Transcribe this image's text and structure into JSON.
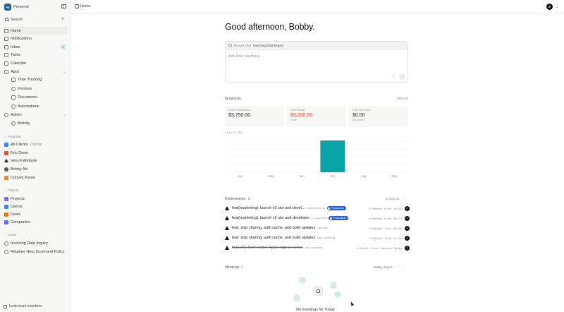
{
  "sidebar": {
    "workspace": {
      "badge": "PE",
      "name": "Personal"
    },
    "search_label": "Search",
    "items": [
      {
        "label": "Home"
      },
      {
        "label": "Notifications"
      },
      {
        "label": "Inbox",
        "badge": "4"
      },
      {
        "label": "Tasks"
      },
      {
        "label": "Calendar"
      },
      {
        "label": "Apps"
      },
      {
        "label": "Time Tracking"
      },
      {
        "label": "Invoices"
      },
      {
        "label": "Documents"
      },
      {
        "label": "Automations"
      },
      {
        "label": "Admin"
      },
      {
        "label": "Activity"
      }
    ],
    "favorites_label": "Favorites",
    "favorites": [
      {
        "label": "All Clients",
        "meta": "Clients"
      },
      {
        "label": "Eric Owen"
      },
      {
        "label": "Verum Website"
      },
      {
        "label": "Bobby Alv"
      },
      {
        "label": "Convex Panel"
      }
    ],
    "objects_label": "Objects",
    "objects": [
      {
        "label": "Projects",
        "color": "#7b6cf0"
      },
      {
        "label": "Clients",
        "color": "#3b82f6"
      },
      {
        "label": "Deals",
        "color": "#f97316"
      },
      {
        "label": "Companies",
        "color": "#6366f1"
      }
    ],
    "chats_label": "Chats",
    "chats": [
      {
        "label": "Invoicing Data Inquiry"
      },
      {
        "label": "Retainer Hour Increment Policy"
      }
    ],
    "invite_label": "Invite team members"
  },
  "topbar": {
    "breadcrumb": "Home",
    "avatar": "Z",
    "more": "⋮"
  },
  "greeting": "Good afternoon, Bobby.",
  "chat": {
    "recent_label": "Recent chat",
    "recent_title": "Invoicing Data Inquiry",
    "placeholder": "Ask Kaio anything...",
    "attach": "⁝",
    "send": "→"
  },
  "financials": {
    "title": "Financials",
    "view_all": "View all",
    "cards": [
      {
        "label": "OUTSTANDING",
        "value": "$3,750.00",
        "sub": ""
      },
      {
        "label": "OVERDUE",
        "value": "$3,000.00",
        "sub": "1 late"
      },
      {
        "label": "COLLECTED",
        "value": "$0.00",
        "sub": "this month"
      }
    ],
    "collected_label": "COLLECTED"
  },
  "chart_data": {
    "type": "bar",
    "categories": [
      "Apr",
      "May",
      "Jun",
      "Jul",
      "Aug",
      "Sep"
    ],
    "values": [
      0,
      0,
      0,
      1,
      0,
      0
    ],
    "ylim": [
      0,
      1
    ],
    "grid": true,
    "bar_color": "#0aa3a8",
    "highlight_category": "Jul"
  },
  "deployments": {
    "title": "Deployments",
    "count": "1L",
    "projects_label": "2 projects",
    "more": "⋮",
    "rows": [
      {
        "msg": "feat(marketing): launch v2 site and devel...",
        "project": "kaio-marketing",
        "env": "Production",
        "commit": "⊙ 9fab9b6",
        "author": "6 min",
        "time": "1m 33s",
        "strike": false
      },
      {
        "msg": "feat(marketing): launch v2 site and developer ...",
        "project": "kaio-web",
        "env": "Production",
        "commit": "⊙ 9fab9b6",
        "author": "6 min",
        "time": "3m 27s",
        "strike": false
      },
      {
        "msg": "feat: ship sharing, auth cache, and build updates",
        "project": "kaio-web",
        "env": "",
        "commit": "⊙ 2f45ac3",
        "author": "7 min",
        "time": "3m 46s",
        "strike": false
      },
      {
        "msg": "feat: ship sharing, auth cache, and build updates",
        "project": "kaio-marketing",
        "env": "",
        "commit": "⊙ 2f45ac3",
        "author": "7 min",
        "time": "1m 35s",
        "strike": false
      },
      {
        "msg": "fix(auth): hash native Apple sign-in nonce",
        "project": "kaio-marketing",
        "env": "",
        "commit": "⊙ 13c4ff1",
        "author": "9 min",
        "time": "Canceled",
        "date": "2d ago",
        "strike": true
      }
    ]
  },
  "meetings": {
    "title": "Meetings",
    "count": "0",
    "date": "Today, Sep 2",
    "prev": "‹",
    "next": "›",
    "empty": "No meetings for Today"
  }
}
